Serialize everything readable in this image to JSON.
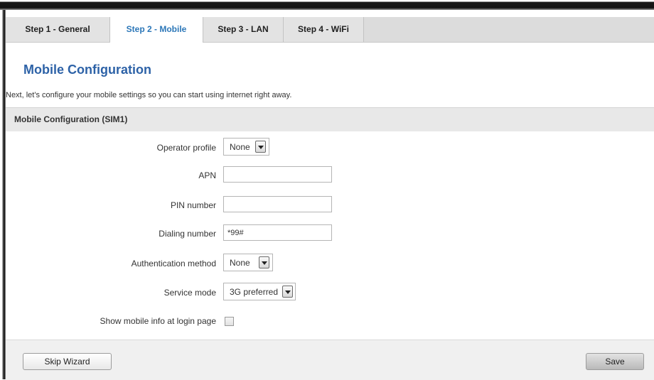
{
  "tabs": [
    {
      "label": "Step 1 - General",
      "active": false
    },
    {
      "label": "Step 2 - Mobile",
      "active": true
    },
    {
      "label": "Step 3 - LAN",
      "active": false
    },
    {
      "label": "Step 4 - WiFi",
      "active": false
    }
  ],
  "page": {
    "title": "Mobile Configuration",
    "intro": "Next, let's configure your mobile settings so you can start using internet right away."
  },
  "section": {
    "title": "Mobile Configuration (SIM1)"
  },
  "form": {
    "operator_profile": {
      "label": "Operator profile",
      "value": "None"
    },
    "apn": {
      "label": "APN",
      "value": ""
    },
    "pin": {
      "label": "PIN number",
      "value": ""
    },
    "dialing": {
      "label": "Dialing number",
      "value": "*99#"
    },
    "auth": {
      "label": "Authentication method",
      "value": "None"
    },
    "service": {
      "label": "Service mode",
      "value": "3G preferred"
    },
    "show_info": {
      "label": "Show mobile info at login page",
      "checked": false
    }
  },
  "footer": {
    "skip_label": "Skip Wizard",
    "save_label": "Save"
  },
  "colors": {
    "accent": "#2c77b8",
    "title": "#2d62a7"
  }
}
